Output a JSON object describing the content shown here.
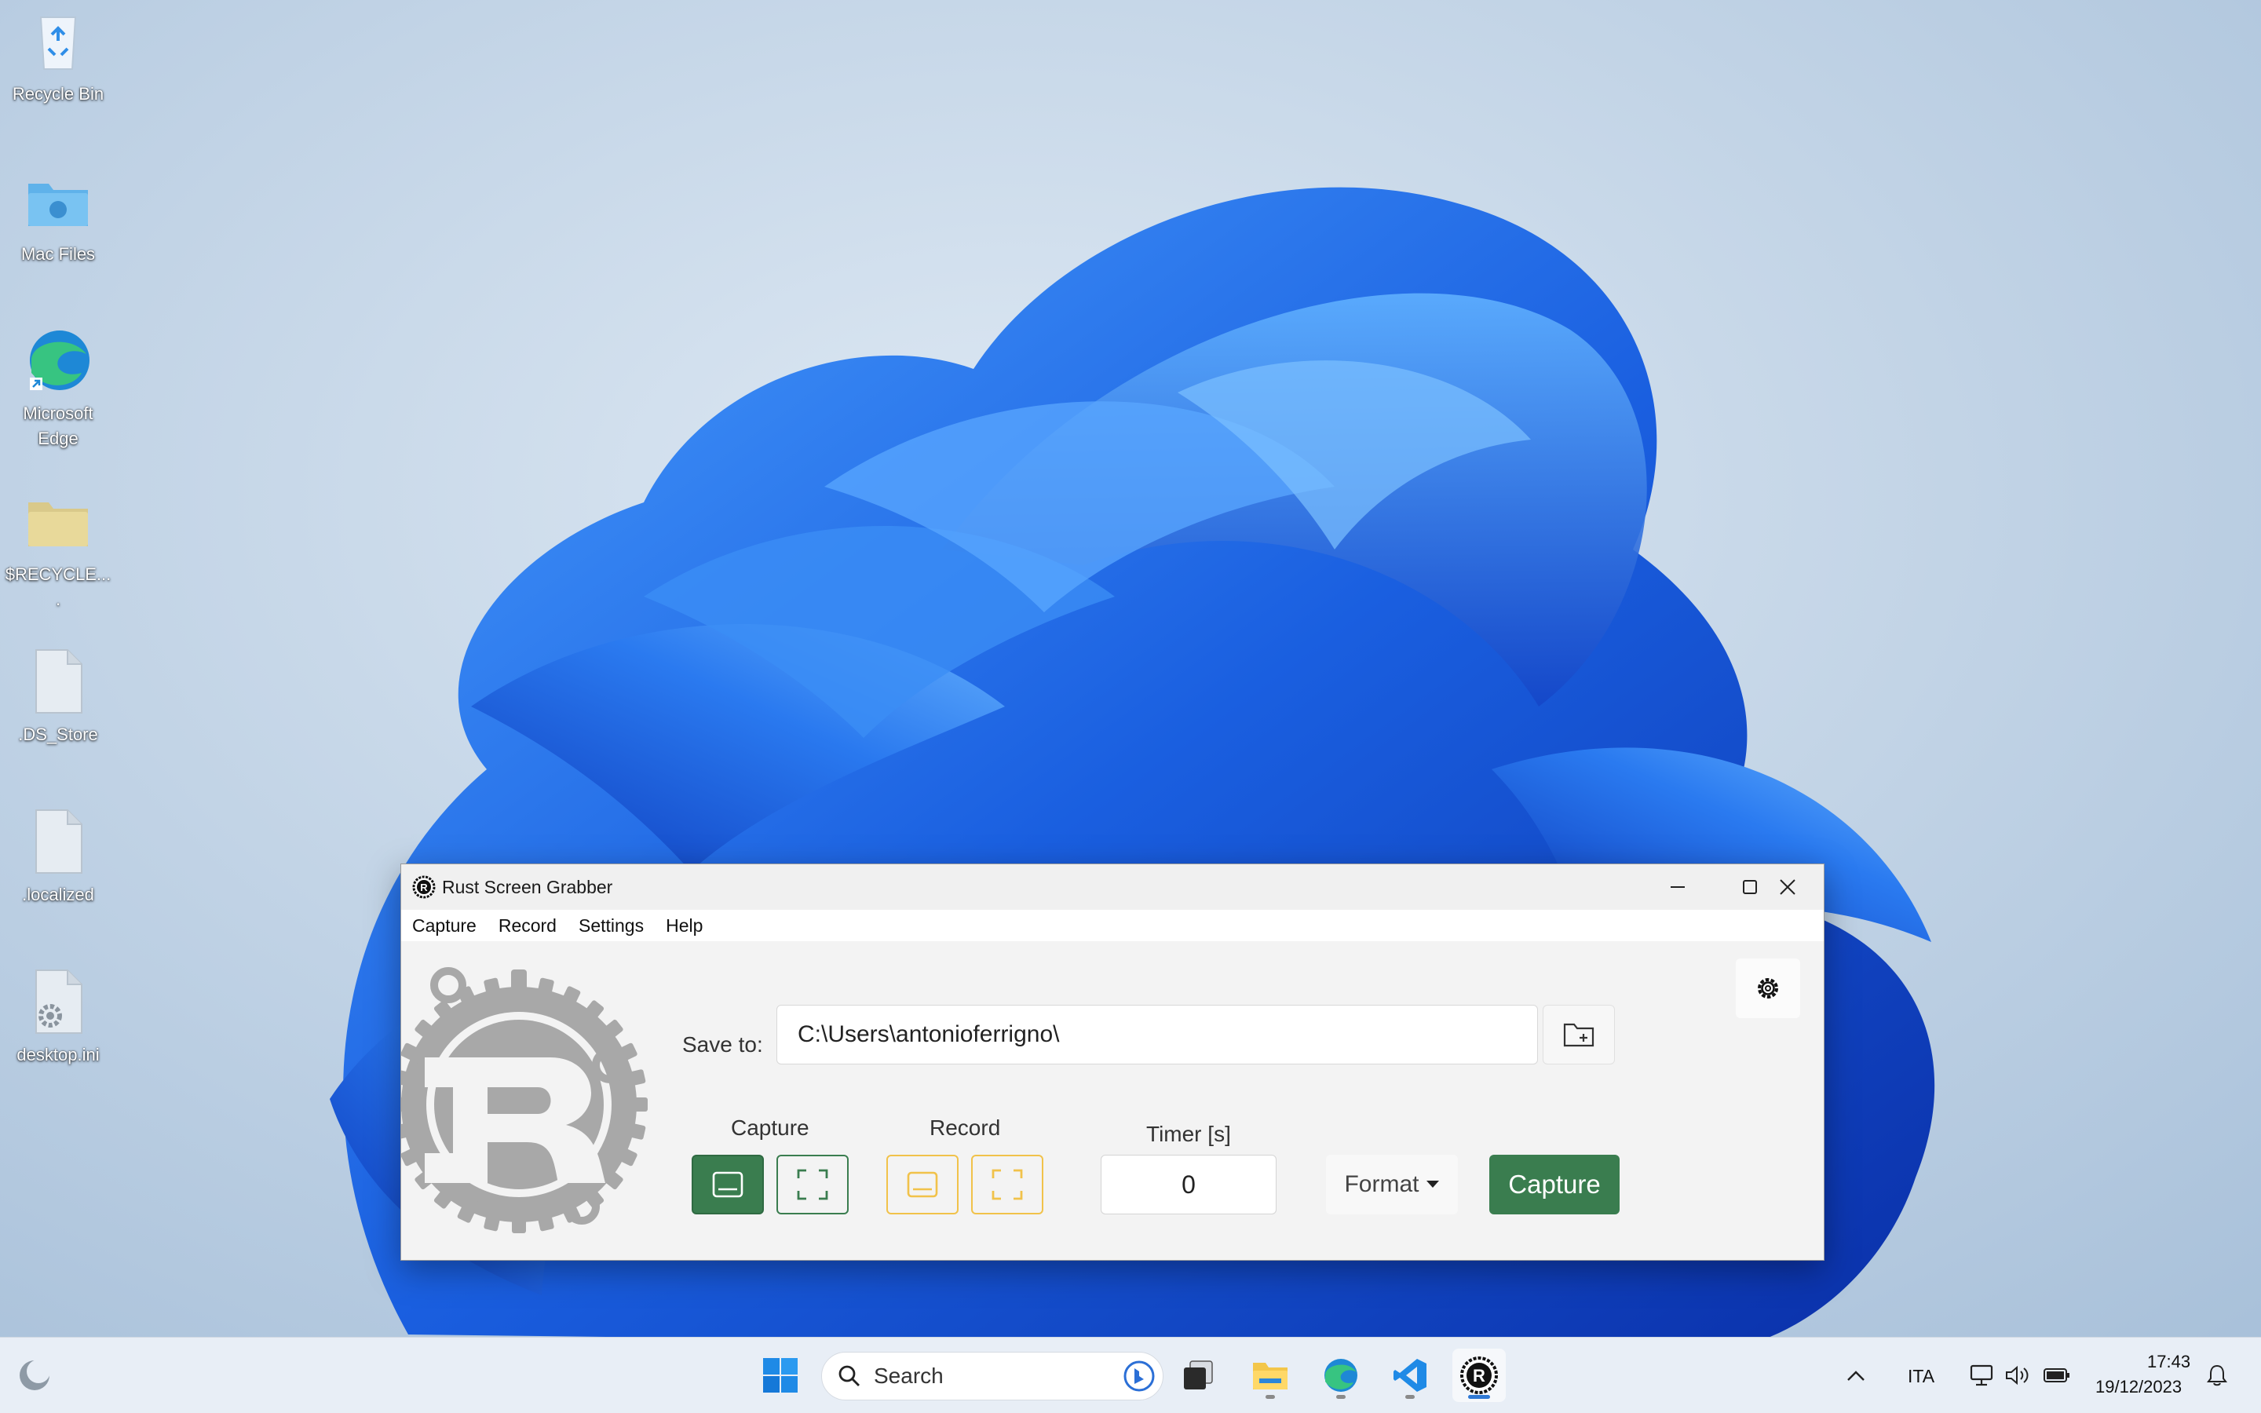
{
  "desktop": {
    "icons": [
      {
        "label": "Recycle Bin",
        "icon": "recycle-bin-icon"
      },
      {
        "label": "Mac Files",
        "icon": "mac-folder-icon"
      },
      {
        "label": "Microsoft Edge",
        "icon": "edge-icon"
      },
      {
        "label": "$RECYCLE....",
        "icon": "folder-icon"
      },
      {
        "label": ".DS_Store",
        "icon": "file-icon"
      },
      {
        "label": ".localized",
        "icon": "file-icon"
      },
      {
        "label": "desktop.ini",
        "icon": "settings-file-icon"
      }
    ]
  },
  "window": {
    "title": "Rust Screen Grabber",
    "menu": [
      "Capture",
      "Record",
      "Settings",
      "Help"
    ],
    "save_label": "Save to:",
    "save_path": "C:\\Users\\antonioferrigno\\",
    "capture_group_label": "Capture",
    "record_group_label": "Record",
    "timer_label": "Timer [s]",
    "timer_value": "0",
    "format_label": "Format",
    "capture_button": "Capture",
    "colors": {
      "primary": "#3a7d4f",
      "record_accent": "#f1c24a"
    }
  },
  "taskbar": {
    "search_placeholder": "Search",
    "language": "ITA",
    "time": "17:43",
    "date": "19/12/2023"
  }
}
